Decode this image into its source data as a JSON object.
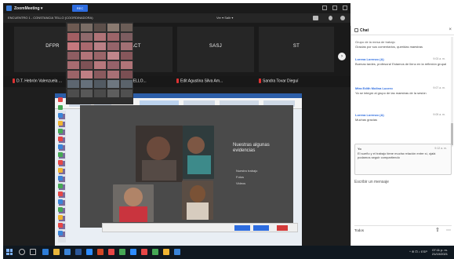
{
  "window": {
    "title": "ZoomMeeting ▾",
    "rec_label": "REC"
  },
  "infobar": {
    "left_text": "ENCUENTRO 1 - CONSTANCIA TELLO (COORDINADORA)",
    "center_text": "Ver  ▾  Salir ▾"
  },
  "participants_strip": {
    "tiles": [
      {
        "label": "DFPR"
      },
      {
        "label": "DACT"
      },
      {
        "label": "SASJ"
      },
      {
        "label": "ST"
      }
    ]
  },
  "name_bar": {
    "names": [
      "D.T. Hebrón Valenzuela ...",
      "D.I. CONSTANZA TELLO...",
      "Edit Agustina Silva Am...",
      "Sandra Tovar Dieguí"
    ]
  },
  "slide": {
    "title": "Nuestras algunas evidencias",
    "bullets": [
      "Nuestro trabajo",
      "Fotos",
      "Videos"
    ]
  },
  "chat": {
    "title": "Chat",
    "messages": [
      {
        "name": "Grupo de la mesa de trabajo",
        "time": "",
        "text": "Gracias por sus comentarios, queridas maestras"
      },
      {
        "name": "Lorena Lorenzo (A)",
        "time": "9:03 a. m.",
        "text": "Buenas tardes, profesora! Estamos de lleno en la reflexión grupal"
      },
      {
        "name": "Mtra Edith Molina Lucero",
        "time": "9:07 a. m.",
        "text": "Ya se integró al grupo de las maestras de la sesión"
      },
      {
        "name": "Lorena Lorenzo (A)",
        "time": "9:09 a. m.",
        "text": "Muchas gracias"
      },
      {
        "name": "Yo",
        "time": "9:12 a. m.",
        "text": "El sueño y el trabajo tiene mucha relación entre sí, ojalá podamos seguir compartiendo"
      }
    ],
    "input_placeholder": "Escribir un mensaje",
    "to_label": "Todos",
    "send_glyph": "⇧",
    "more_glyph": "⋯"
  },
  "taskbar": {
    "tray_text": "^  ⊕  ⊡  ♪  ESP",
    "time": "07:11 p. m.",
    "date": "21/10/2021"
  },
  "colors": {
    "accent": "#2d6cdf",
    "meeting_bg": "#1f1f1f",
    "slide_bg": "#4a4a4a"
  }
}
